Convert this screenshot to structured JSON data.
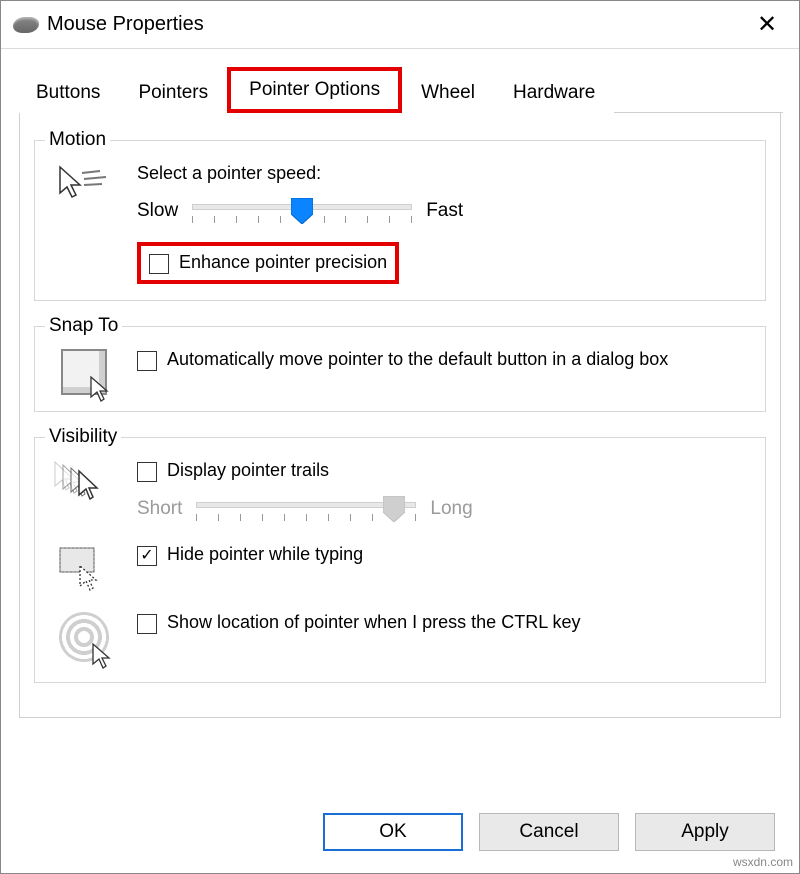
{
  "window": {
    "title": "Mouse Properties"
  },
  "tabs": {
    "buttons": "Buttons",
    "pointers": "Pointers",
    "pointer_options": "Pointer Options",
    "wheel": "Wheel",
    "hardware": "Hardware",
    "active": "Pointer Options"
  },
  "motion": {
    "legend": "Motion",
    "select_label": "Select a pointer speed:",
    "slow": "Slow",
    "fast": "Fast",
    "speed_value": 5,
    "speed_ticks": 11,
    "enhance_label": "Enhance pointer precision",
    "enhance_checked": false
  },
  "snap": {
    "legend": "Snap To",
    "label": "Automatically move pointer to the default button in a dialog box",
    "checked": false
  },
  "visibility": {
    "legend": "Visibility",
    "trails_label": "Display pointer trails",
    "trails_checked": false,
    "trails_short": "Short",
    "trails_long": "Long",
    "trails_value": 9,
    "trails_ticks": 11,
    "hide_label": "Hide pointer while typing",
    "hide_checked": true,
    "ctrl_label": "Show location of pointer when I press the CTRL key",
    "ctrl_checked": false
  },
  "buttons_bar": {
    "ok": "OK",
    "cancel": "Cancel",
    "apply": "Apply"
  },
  "watermark": "wsxdn.com"
}
